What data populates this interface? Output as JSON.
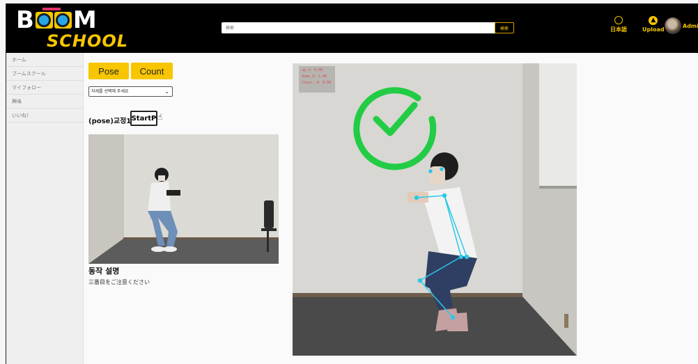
{
  "header": {
    "logo_top": "B  M",
    "logo_bottom": "SCHOOL",
    "search_placeholder": "検索",
    "search_button": "検索",
    "language_label": "日本語",
    "upload_label": "Upload",
    "user_label": "Admin"
  },
  "sidebar": {
    "items": [
      {
        "label": "ホーム"
      },
      {
        "label": "ブームスクール"
      },
      {
        "label": "マイフォロー"
      },
      {
        "label": "興味"
      },
      {
        "label": "いいね！"
      }
    ]
  },
  "main": {
    "pose_button": "Pose",
    "count_button": "Count",
    "select_value": "자세를 선택해 주세요",
    "pose_title": "(pose)교정1",
    "start_button": "StartP",
    "description_title": "동작 설명",
    "description_text": "三番目をご注意ください"
  },
  "camera": {
    "stats": {
      "line1": "up_2: 0.00",
      "line2": "down_3: 1.00",
      "line3": "Class: 4: 0.00"
    }
  },
  "colors": {
    "accent_yellow": "#f7c600",
    "check_green": "#22cc44",
    "skeleton_cyan": "#29c8e8"
  }
}
